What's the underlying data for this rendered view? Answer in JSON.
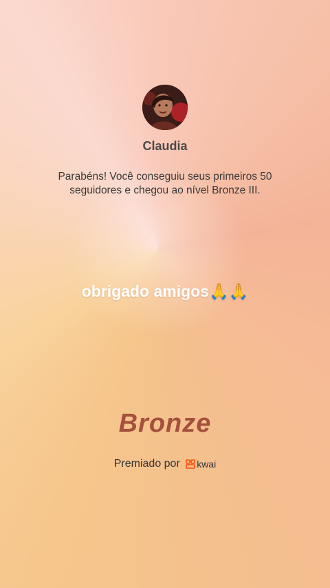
{
  "profile": {
    "name": "Claudia",
    "avatar_icon": "profile-photo"
  },
  "message": "Parabéns! Você conseguiu seus primeiros 50 seguidores e chegou ao nível Bronze III.",
  "caption": "obrigado amigos🙏🙏",
  "level": "Bronze",
  "awarded": {
    "label": "Premiado por",
    "brand_name": "kwai",
    "brand_icon": "kwai-logo-icon",
    "brand_color": "#ff4906"
  }
}
